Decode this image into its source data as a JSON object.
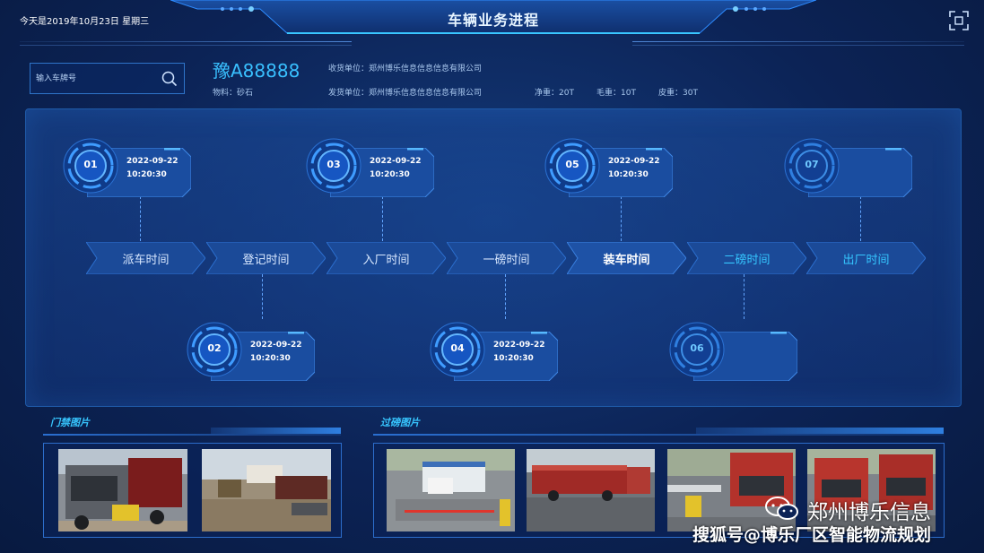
{
  "header": {
    "date_text": "今天是2019年10月23日  星期三",
    "title": "车辆业务进程"
  },
  "search": {
    "placeholder": "输入车牌号"
  },
  "vehicle": {
    "plate": "豫A88888",
    "material": "物料：砂石",
    "receiver": "收货单位：郑州博乐信息信息信息有限公司",
    "sender": "发货单位：郑州博乐信息信息信息有限公司",
    "net_weight": "净重：20T",
    "gross_weight": "毛重：10T",
    "tare_weight": "皮重：30T"
  },
  "steps": [
    {
      "label": "派车时间",
      "state": "done"
    },
    {
      "label": "登记时间",
      "state": "done"
    },
    {
      "label": "入厂时间",
      "state": "done"
    },
    {
      "label": "一磅时间",
      "state": "done"
    },
    {
      "label": "装车时间",
      "state": "active"
    },
    {
      "label": "二磅时间",
      "state": "pending"
    },
    {
      "label": "出厂时间",
      "state": "pending"
    }
  ],
  "nodes": [
    {
      "num": "01",
      "date": "2022-09-22",
      "time": "10:20:30"
    },
    {
      "num": "02",
      "date": "2022-09-22",
      "time": "10:20:30"
    },
    {
      "num": "03",
      "date": "2022-09-22",
      "time": "10:20:30"
    },
    {
      "num": "04",
      "date": "2022-09-22",
      "time": "10:20:30"
    },
    {
      "num": "05",
      "date": "2022-09-22",
      "time": "10:20:30"
    },
    {
      "num": "06",
      "date": "",
      "time": ""
    },
    {
      "num": "07",
      "date": "",
      "time": ""
    }
  ],
  "sections": {
    "gate_photos": "门禁图片",
    "weigh_photos": "过磅图片"
  },
  "watermark": {
    "brand": "郑州博乐信息",
    "caption": "搜狐号@博乐厂区智能物流规划"
  },
  "colors": {
    "accent": "#37c6ff",
    "panel_border": "#1f5aa8",
    "background": "#0c2356"
  }
}
